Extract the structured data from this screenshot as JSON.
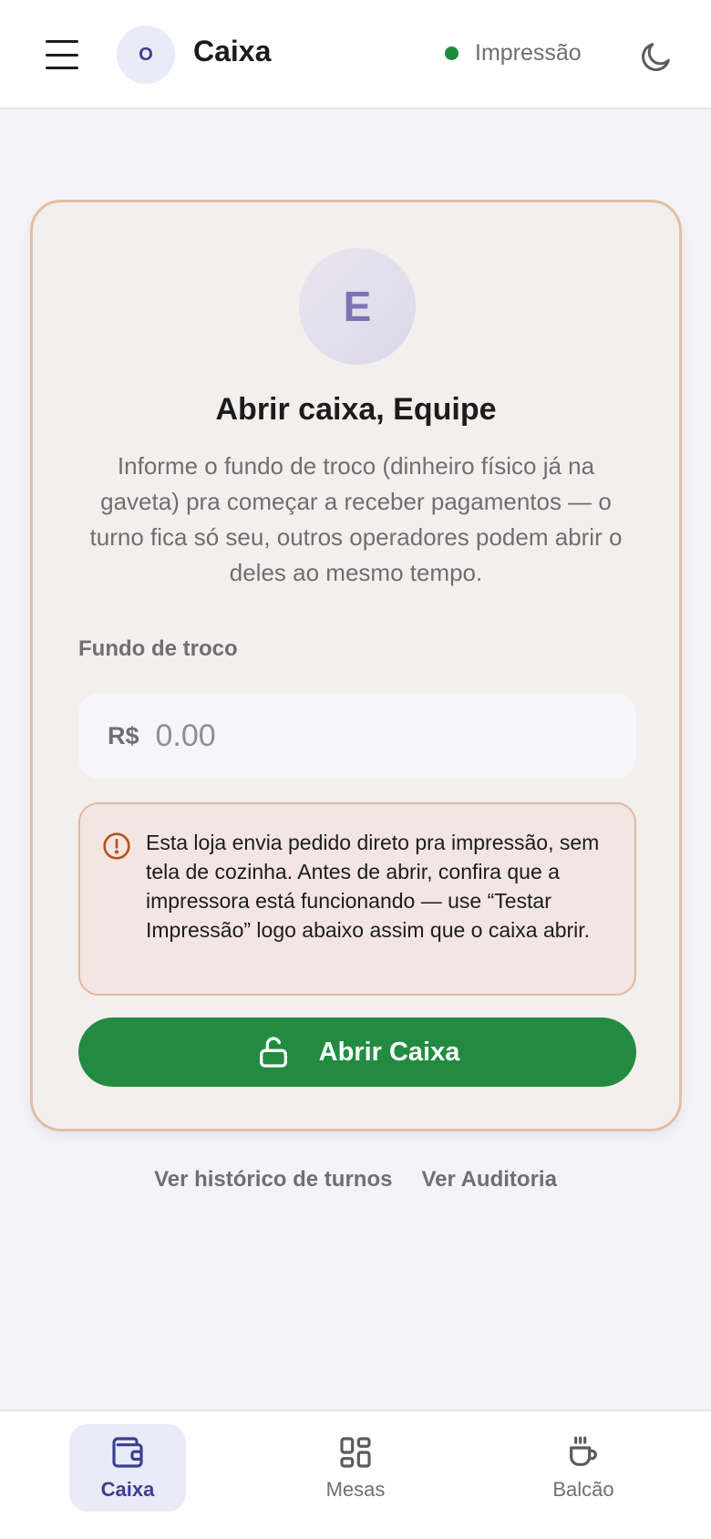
{
  "header": {
    "avatar_initial": "O",
    "title": "Caixa",
    "print_status": "Impressão",
    "colors": {
      "status_ok": "#1e8a3c",
      "accent": "#3a3f8f"
    }
  },
  "card": {
    "avatar_initial": "E",
    "title": "Abrir caixa, Equipe",
    "description": "Informe o fundo de troco (dinheiro físico já na gaveta) pra começar a receber pagamentos — o turno fica só seu, outros operadores podem abrir o deles ao mesmo tempo.",
    "field_label": "Fundo de troco",
    "currency": "R$",
    "amount_placeholder": "0.00",
    "amount_value": "",
    "alert_text": "Esta loja envia pedido direto pra impressão, sem tela de cozinha. Antes de abrir, confira que a impressora está funcionando — use “Testar Impressão” logo abaixo assim que o caixa abrir.",
    "open_button_label": "Abrir Caixa",
    "colors": {
      "primary": "#228b41",
      "warning": "#b3541e"
    }
  },
  "links": {
    "history": "Ver histórico de turnos",
    "audit": "Ver Auditoria"
  },
  "bottom_nav": {
    "items": [
      {
        "label": "Caixa",
        "icon": "wallet-icon",
        "active": true
      },
      {
        "label": "Mesas",
        "icon": "grid-icon",
        "active": false
      },
      {
        "label": "Balcão",
        "icon": "coffee-cup-icon",
        "active": false
      }
    ]
  }
}
